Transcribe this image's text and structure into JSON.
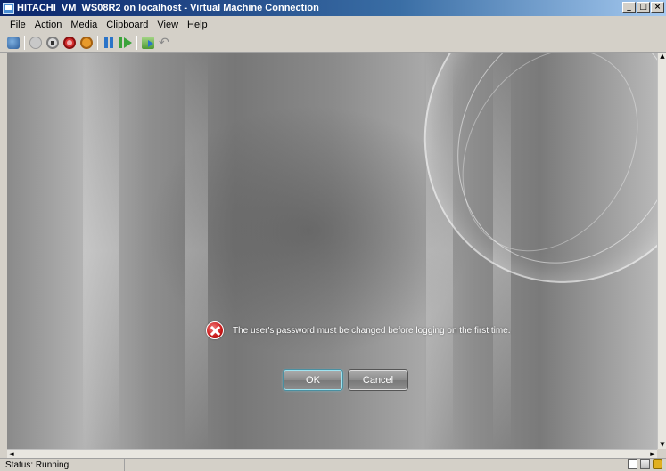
{
  "window": {
    "title": "HITACHI_VM_WS08R2 on localhost - Virtual Machine Connection",
    "caption_buttons": {
      "minimize": "_",
      "maximize": "□",
      "close": "×"
    }
  },
  "menu": [
    {
      "label": "File"
    },
    {
      "label": "Action"
    },
    {
      "label": "Media"
    },
    {
      "label": "Clipboard"
    },
    {
      "label": "View"
    },
    {
      "label": "Help"
    }
  ],
  "toolbar": {
    "icons": [
      "ctrl-alt-del-icon",
      "start-icon",
      "turn-off-icon",
      "shut-down-icon",
      "save-icon",
      "pause-icon",
      "resume-icon",
      "snapshot-icon",
      "revert-icon"
    ]
  },
  "dialog": {
    "message": "The user's password must be changed before logging on the first time.",
    "ok_label": "OK",
    "cancel_label": "Cancel"
  },
  "status": {
    "text": "Status: Running"
  },
  "scroll_arrows": {
    "up": "▲",
    "down": "▼",
    "left": "◄",
    "right": "►"
  }
}
